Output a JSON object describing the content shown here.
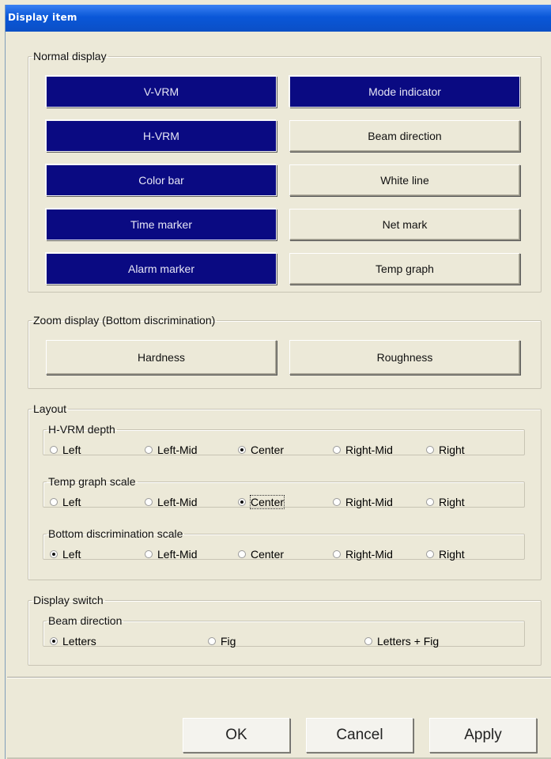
{
  "window": {
    "title": "Display item"
  },
  "normal_display": {
    "legend": "Normal display",
    "buttons": [
      {
        "label": "V-VRM",
        "active": true
      },
      {
        "label": "Mode indicator",
        "active": true
      },
      {
        "label": "H-VRM",
        "active": true
      },
      {
        "label": "Beam direction",
        "active": false
      },
      {
        "label": "Color bar",
        "active": true
      },
      {
        "label": "White line",
        "active": false
      },
      {
        "label": "Time marker",
        "active": true
      },
      {
        "label": "Net mark",
        "active": false
      },
      {
        "label": "Alarm marker",
        "active": true
      },
      {
        "label": "Temp graph",
        "active": false
      }
    ]
  },
  "zoom_display": {
    "legend": "Zoom display (Bottom discrimination)",
    "buttons": [
      {
        "label": "Hardness",
        "active": false
      },
      {
        "label": "Roughness",
        "active": false
      }
    ]
  },
  "layout": {
    "legend": "Layout",
    "groups": [
      {
        "legend": "H-VRM depth",
        "options": [
          "Left",
          "Left-Mid",
          "Center",
          "Right-Mid",
          "Right"
        ],
        "selected": "Center"
      },
      {
        "legend": "Temp graph scale",
        "options": [
          "Left",
          "Left-Mid",
          "Center",
          "Right-Mid",
          "Right"
        ],
        "selected": "Center"
      },
      {
        "legend": "Bottom discrimination scale",
        "options": [
          "Left",
          "Left-Mid",
          "Center",
          "Right-Mid",
          "Right"
        ],
        "selected": "Left"
      }
    ]
  },
  "display_switch": {
    "legend": "Display switch",
    "groups": [
      {
        "legend": "Beam direction",
        "options": [
          "Letters",
          "Fig",
          "Letters + Fig"
        ],
        "selected": "Letters"
      }
    ]
  },
  "dialog_buttons": {
    "ok": "OK",
    "cancel": "Cancel",
    "apply": "Apply"
  },
  "colors": {
    "active_button_bg": "#0a0a82",
    "titlebar": "#0a57d8",
    "dialog_bg": "#ece9d8"
  }
}
